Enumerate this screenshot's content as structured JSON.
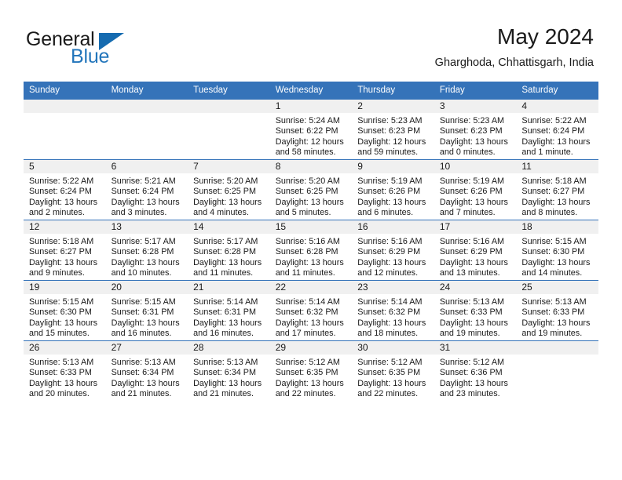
{
  "brand": {
    "name_part1": "General",
    "name_part2": "Blue",
    "accent_color": "#2275bb",
    "triangle_color": "#156bb0"
  },
  "header": {
    "month_title": "May 2024",
    "location": "Gharghoda, Chhattisgarh, India"
  },
  "calendar": {
    "header_bg": "#3573b9",
    "daynum_bg": "#f0f0f0",
    "weekdays": [
      "Sunday",
      "Monday",
      "Tuesday",
      "Wednesday",
      "Thursday",
      "Friday",
      "Saturday"
    ],
    "weeks": [
      [
        {
          "day": "",
          "lines": []
        },
        {
          "day": "",
          "lines": []
        },
        {
          "day": "",
          "lines": []
        },
        {
          "day": "1",
          "lines": [
            "Sunrise: 5:24 AM",
            "Sunset: 6:22 PM",
            "Daylight: 12 hours",
            "and 58 minutes."
          ]
        },
        {
          "day": "2",
          "lines": [
            "Sunrise: 5:23 AM",
            "Sunset: 6:23 PM",
            "Daylight: 12 hours",
            "and 59 minutes."
          ]
        },
        {
          "day": "3",
          "lines": [
            "Sunrise: 5:23 AM",
            "Sunset: 6:23 PM",
            "Daylight: 13 hours",
            "and 0 minutes."
          ]
        },
        {
          "day": "4",
          "lines": [
            "Sunrise: 5:22 AM",
            "Sunset: 6:24 PM",
            "Daylight: 13 hours",
            "and 1 minute."
          ]
        }
      ],
      [
        {
          "day": "5",
          "lines": [
            "Sunrise: 5:22 AM",
            "Sunset: 6:24 PM",
            "Daylight: 13 hours",
            "and 2 minutes."
          ]
        },
        {
          "day": "6",
          "lines": [
            "Sunrise: 5:21 AM",
            "Sunset: 6:24 PM",
            "Daylight: 13 hours",
            "and 3 minutes."
          ]
        },
        {
          "day": "7",
          "lines": [
            "Sunrise: 5:20 AM",
            "Sunset: 6:25 PM",
            "Daylight: 13 hours",
            "and 4 minutes."
          ]
        },
        {
          "day": "8",
          "lines": [
            "Sunrise: 5:20 AM",
            "Sunset: 6:25 PM",
            "Daylight: 13 hours",
            "and 5 minutes."
          ]
        },
        {
          "day": "9",
          "lines": [
            "Sunrise: 5:19 AM",
            "Sunset: 6:26 PM",
            "Daylight: 13 hours",
            "and 6 minutes."
          ]
        },
        {
          "day": "10",
          "lines": [
            "Sunrise: 5:19 AM",
            "Sunset: 6:26 PM",
            "Daylight: 13 hours",
            "and 7 minutes."
          ]
        },
        {
          "day": "11",
          "lines": [
            "Sunrise: 5:18 AM",
            "Sunset: 6:27 PM",
            "Daylight: 13 hours",
            "and 8 minutes."
          ]
        }
      ],
      [
        {
          "day": "12",
          "lines": [
            "Sunrise: 5:18 AM",
            "Sunset: 6:27 PM",
            "Daylight: 13 hours",
            "and 9 minutes."
          ]
        },
        {
          "day": "13",
          "lines": [
            "Sunrise: 5:17 AM",
            "Sunset: 6:28 PM",
            "Daylight: 13 hours",
            "and 10 minutes."
          ]
        },
        {
          "day": "14",
          "lines": [
            "Sunrise: 5:17 AM",
            "Sunset: 6:28 PM",
            "Daylight: 13 hours",
            "and 11 minutes."
          ]
        },
        {
          "day": "15",
          "lines": [
            "Sunrise: 5:16 AM",
            "Sunset: 6:28 PM",
            "Daylight: 13 hours",
            "and 11 minutes."
          ]
        },
        {
          "day": "16",
          "lines": [
            "Sunrise: 5:16 AM",
            "Sunset: 6:29 PM",
            "Daylight: 13 hours",
            "and 12 minutes."
          ]
        },
        {
          "day": "17",
          "lines": [
            "Sunrise: 5:16 AM",
            "Sunset: 6:29 PM",
            "Daylight: 13 hours",
            "and 13 minutes."
          ]
        },
        {
          "day": "18",
          "lines": [
            "Sunrise: 5:15 AM",
            "Sunset: 6:30 PM",
            "Daylight: 13 hours",
            "and 14 minutes."
          ]
        }
      ],
      [
        {
          "day": "19",
          "lines": [
            "Sunrise: 5:15 AM",
            "Sunset: 6:30 PM",
            "Daylight: 13 hours",
            "and 15 minutes."
          ]
        },
        {
          "day": "20",
          "lines": [
            "Sunrise: 5:15 AM",
            "Sunset: 6:31 PM",
            "Daylight: 13 hours",
            "and 16 minutes."
          ]
        },
        {
          "day": "21",
          "lines": [
            "Sunrise: 5:14 AM",
            "Sunset: 6:31 PM",
            "Daylight: 13 hours",
            "and 16 minutes."
          ]
        },
        {
          "day": "22",
          "lines": [
            "Sunrise: 5:14 AM",
            "Sunset: 6:32 PM",
            "Daylight: 13 hours",
            "and 17 minutes."
          ]
        },
        {
          "day": "23",
          "lines": [
            "Sunrise: 5:14 AM",
            "Sunset: 6:32 PM",
            "Daylight: 13 hours",
            "and 18 minutes."
          ]
        },
        {
          "day": "24",
          "lines": [
            "Sunrise: 5:13 AM",
            "Sunset: 6:33 PM",
            "Daylight: 13 hours",
            "and 19 minutes."
          ]
        },
        {
          "day": "25",
          "lines": [
            "Sunrise: 5:13 AM",
            "Sunset: 6:33 PM",
            "Daylight: 13 hours",
            "and 19 minutes."
          ]
        }
      ],
      [
        {
          "day": "26",
          "lines": [
            "Sunrise: 5:13 AM",
            "Sunset: 6:33 PM",
            "Daylight: 13 hours",
            "and 20 minutes."
          ]
        },
        {
          "day": "27",
          "lines": [
            "Sunrise: 5:13 AM",
            "Sunset: 6:34 PM",
            "Daylight: 13 hours",
            "and 21 minutes."
          ]
        },
        {
          "day": "28",
          "lines": [
            "Sunrise: 5:13 AM",
            "Sunset: 6:34 PM",
            "Daylight: 13 hours",
            "and 21 minutes."
          ]
        },
        {
          "day": "29",
          "lines": [
            "Sunrise: 5:12 AM",
            "Sunset: 6:35 PM",
            "Daylight: 13 hours",
            "and 22 minutes."
          ]
        },
        {
          "day": "30",
          "lines": [
            "Sunrise: 5:12 AM",
            "Sunset: 6:35 PM",
            "Daylight: 13 hours",
            "and 22 minutes."
          ]
        },
        {
          "day": "31",
          "lines": [
            "Sunrise: 5:12 AM",
            "Sunset: 6:36 PM",
            "Daylight: 13 hours",
            "and 23 minutes."
          ]
        },
        {
          "day": "",
          "lines": []
        }
      ]
    ]
  }
}
